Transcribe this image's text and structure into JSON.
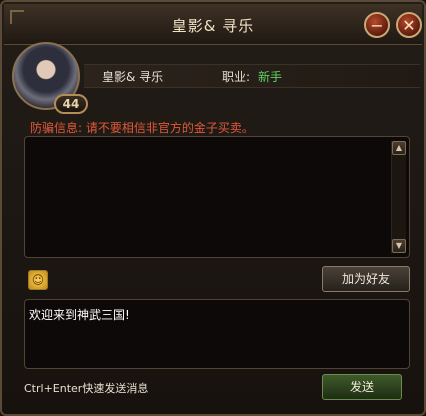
{
  "window": {
    "title": "皇影& 寻乐"
  },
  "titlebar": {
    "minimize_icon": "minus-icon",
    "close_icon": "close-icon",
    "minimize_glyph": "−",
    "close_glyph": "✕"
  },
  "profile": {
    "level": "44",
    "name": "皇影& 寻乐",
    "job_label": "职业:",
    "job_value": "新手",
    "job_color": "#5ed35e"
  },
  "warning": {
    "text": "防骗信息: 请不要相信非官方的金子买卖。",
    "color": "#e0593b"
  },
  "chat": {
    "scroll_up_glyph": "▲",
    "scroll_down_glyph": "▼"
  },
  "actions": {
    "emoji_icon": "smiley-icon",
    "emoji_glyph": "☺",
    "add_friend_label": "加为好友"
  },
  "input": {
    "value": "欢迎来到神武三国!"
  },
  "footer": {
    "hint": "Ctrl+Enter快速发送消息",
    "send_label": "发送"
  }
}
